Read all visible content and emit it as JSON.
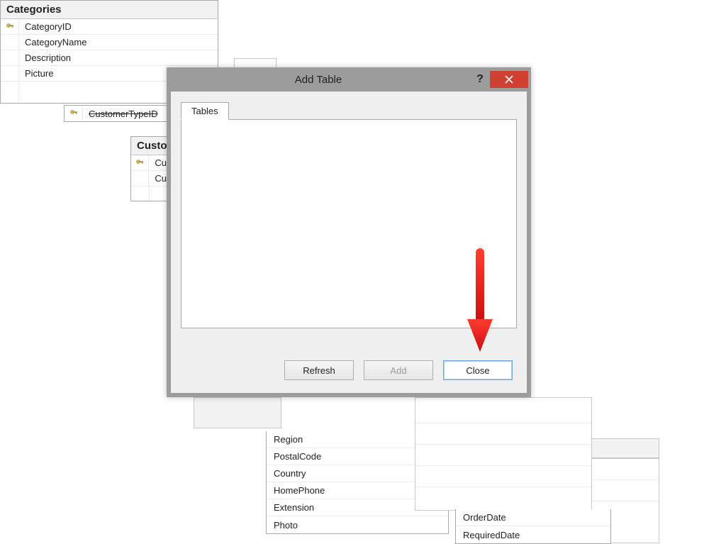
{
  "tables": {
    "categories": {
      "title": "Categories",
      "fields": [
        {
          "key": true,
          "name": "CategoryID"
        },
        {
          "key": false,
          "name": "CategoryName"
        },
        {
          "key": false,
          "name": "Description"
        },
        {
          "key": false,
          "name": "Picture"
        }
      ]
    },
    "customers_partial": {
      "title_fragment": "Custo",
      "fields": [
        {
          "key": true,
          "name_fragment": "Cu"
        },
        {
          "key": false,
          "name_fragment": "Cu"
        }
      ]
    },
    "hidden_behind": {
      "field_fragment": "CustomerTypeID"
    },
    "employees_visible_rows": [
      "Region",
      "PostalCode",
      "Country",
      "HomePhone",
      "Extension",
      "Photo"
    ],
    "orders_visible_rows": [
      "OrderDate",
      "RequiredDate"
    ]
  },
  "dialog": {
    "title": "Add Table",
    "tab": "Tables",
    "buttons": {
      "refresh": "Refresh",
      "add": "Add",
      "close": "Close"
    }
  }
}
